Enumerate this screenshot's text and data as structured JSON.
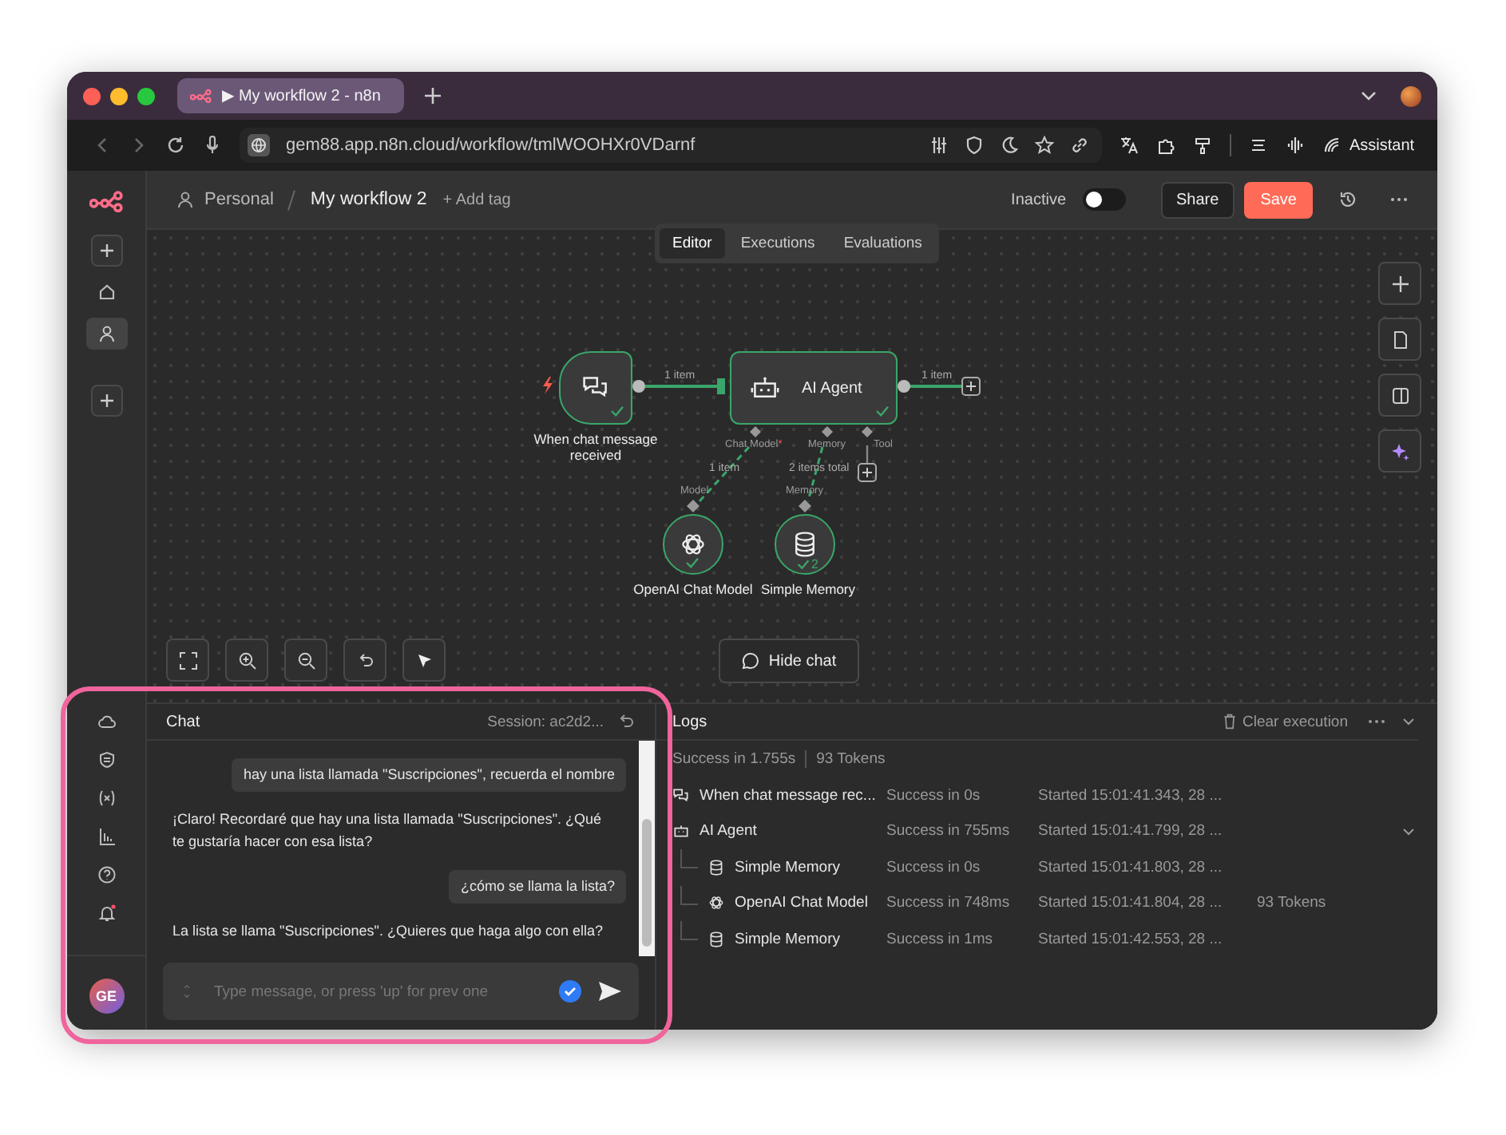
{
  "browser": {
    "tab_title": "▶ My workflow 2 - n8n",
    "url": "gem88.app.n8n.cloud/workflow/tmlWOOHXr0VDarnf",
    "assistant": "Assistant"
  },
  "header": {
    "breadcrumb": "Personal",
    "workflow_name": "My workflow 2",
    "add_tag": "+ Add tag",
    "status": "Inactive",
    "active": false,
    "share": "Share",
    "save": "Save"
  },
  "view_tabs": [
    {
      "label": "Editor",
      "selected": true
    },
    {
      "label": "Executions",
      "selected": false
    },
    {
      "label": "Evaluations",
      "selected": false
    }
  ],
  "nodes": [
    {
      "kind": "trigger",
      "label": "When chat message received"
    },
    {
      "kind": "agent",
      "label": "AI Agent"
    },
    {
      "kind": "model",
      "label": "OpenAI Chat Model"
    },
    {
      "kind": "memory",
      "label": "Simple Memory",
      "badge": "2"
    }
  ],
  "connection_labels": [
    "1 item",
    "1 item",
    "1 item",
    "2 items total"
  ],
  "agent_ports": [
    {
      "label": "Chat Model",
      "required": true
    },
    {
      "label": "Memory",
      "required": false
    },
    {
      "label": "Tool",
      "required": false
    }
  ],
  "required_mark": "*",
  "sub_ports": [
    "Model",
    "Memory"
  ],
  "hide_chat": "Hide chat",
  "chat": {
    "title": "Chat",
    "session": "Session: ac2d2...",
    "placeholder": "Type message, or press 'up' for prev one",
    "messages": [
      {
        "kind": "user",
        "text": "hay una lista llamada \"Suscripciones\", recuerda el nombre"
      },
      {
        "kind": "bot",
        "text": "¡Claro! Recordaré que hay una lista llamada \"Suscripciones\". ¿Qué te gustaría hacer con esa lista?"
      },
      {
        "kind": "user",
        "text": "¿cómo se llama la lista?"
      },
      {
        "kind": "bot",
        "text": "La lista se llama \"Suscripciones\". ¿Quieres que haga algo con ella?"
      }
    ]
  },
  "logs": {
    "title": "Logs",
    "clear": "Clear execution",
    "summary": "Success in 1.755s",
    "tokens": "93 Tokens",
    "rows": [
      {
        "kind": "chat",
        "name": "When chat message rec...",
        "status": "Success in 0s",
        "started": "Started 15:01:41.343, 28 ..."
      },
      {
        "kind": "robot",
        "name": "AI Agent",
        "status": "Success in 755ms",
        "started": "Started 15:01:41.799, 28 ...",
        "expanded": true,
        "children": [
          {
            "kind": "database",
            "name": "Simple Memory",
            "status": "Success in 0s",
            "started": "Started 15:01:41.803, 28 ..."
          },
          {
            "kind": "openai",
            "name": "OpenAI Chat Model",
            "status": "Success in 748ms",
            "started": "Started 15:01:41.804, 28 ...",
            "tokens": "93 Tokens"
          },
          {
            "kind": "database",
            "name": "Simple Memory",
            "status": "Success in 1ms",
            "started": "Started 15:01:42.553, 28 ..."
          }
        ]
      }
    ]
  },
  "user": {
    "initials": "GE"
  }
}
